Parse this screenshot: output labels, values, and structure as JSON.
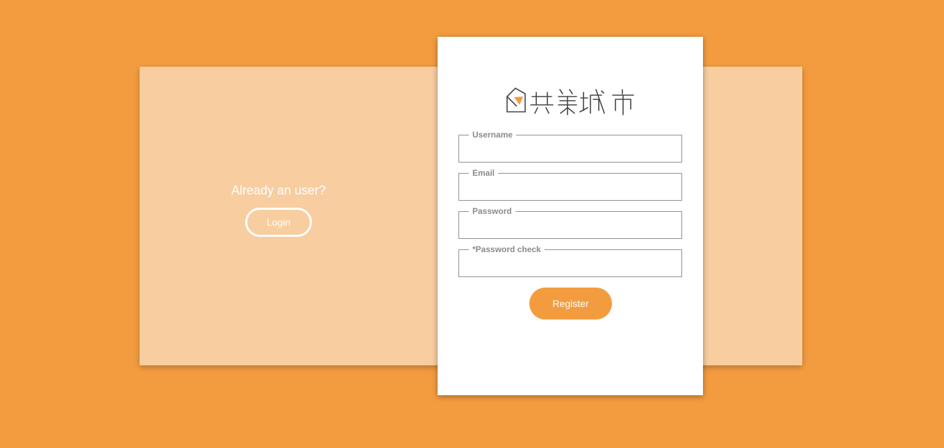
{
  "colors": {
    "background": "#f39c3f",
    "panel": "#f8cda0",
    "card": "#ffffff",
    "accent": "#f39c3f",
    "label": "#8a8a8a"
  },
  "left_panel": {
    "title": "Already an user?",
    "login_label": "Login"
  },
  "logo": {
    "text": "共築城市",
    "icon": "house-tile-icon"
  },
  "form": {
    "fields": [
      {
        "label": "Username",
        "value": "",
        "placeholder": ""
      },
      {
        "label": "Email",
        "value": "",
        "placeholder": ""
      },
      {
        "label": "Password",
        "value": "",
        "placeholder": ""
      },
      {
        "label": "*Password check",
        "value": "",
        "placeholder": ""
      }
    ],
    "register_label": "Register"
  }
}
